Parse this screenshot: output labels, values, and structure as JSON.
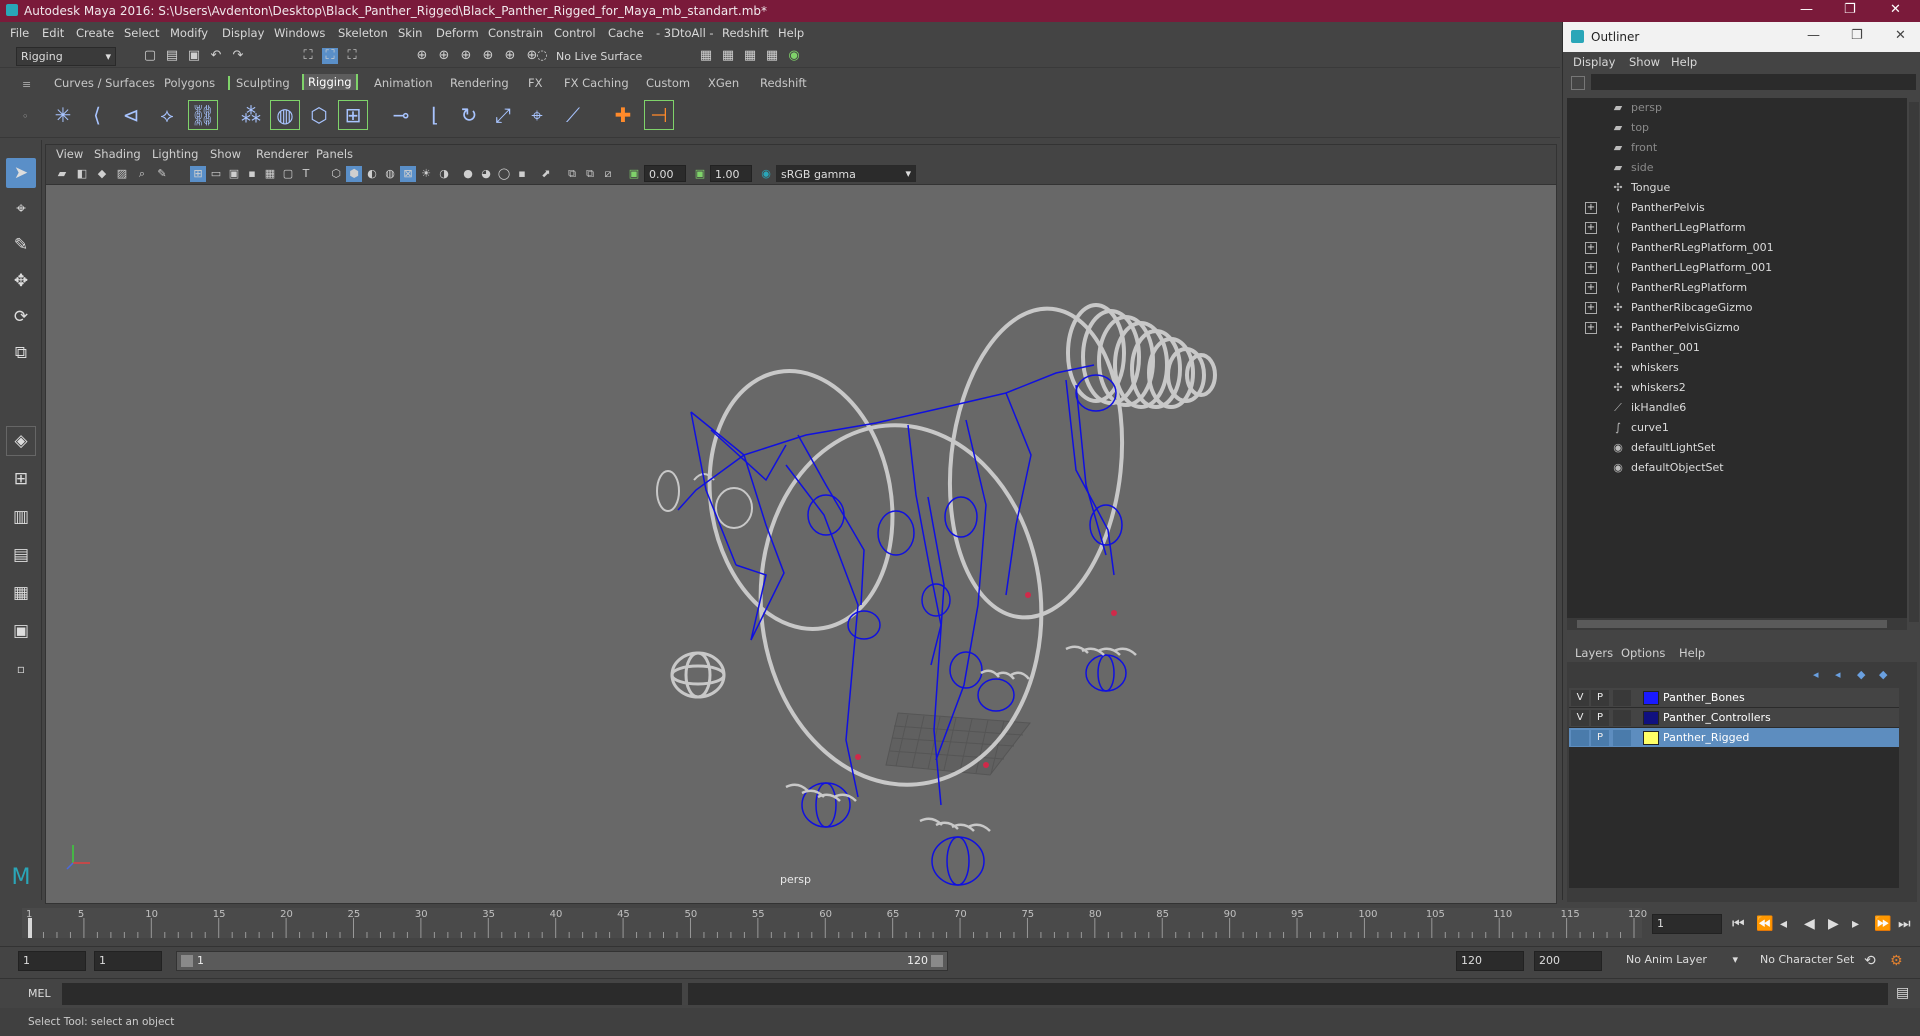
{
  "window": {
    "title": "Autodesk Maya 2016: S:\\Users\\Avdenton\\Desktop\\Black_Panther_Rigged\\Black_Panther_Rigged_for_Maya_mb_standart.mb*",
    "minimize": "—",
    "restore": "❐",
    "close": "✕"
  },
  "menubar": [
    "File",
    "Edit",
    "Create",
    "Select",
    "Modify",
    "Display",
    "Windows",
    "Skeleton",
    "Skin",
    "Deform",
    "Constrain",
    "Control",
    "Cache",
    "- 3DtoAll -",
    "Redshift",
    "Help"
  ],
  "statusline": {
    "menuset": "Rigging",
    "live_surface": "No Live Surface"
  },
  "shelf": {
    "tabs": [
      "Curves / Surfaces",
      "Polygons",
      "Sculpting",
      "Rigging",
      "Animation",
      "Rendering",
      "FX",
      "FX Caching",
      "Custom",
      "XGen",
      "Redshift"
    ],
    "active_tab": "Rigging"
  },
  "viewport": {
    "menu": [
      "View",
      "Shading",
      "Lighting",
      "Show",
      "Renderer",
      "Panels"
    ],
    "field_exposure": "0.00",
    "field_gamma": "1.00",
    "color_space": "sRGB gamma",
    "camera_label": "persp"
  },
  "outliner": {
    "title": "Outliner",
    "menu": [
      "Display",
      "Show",
      "Help"
    ],
    "items": [
      {
        "label": "persp",
        "icon": "camera-icon",
        "expandable": false,
        "dim": true
      },
      {
        "label": "top",
        "icon": "camera-icon",
        "expandable": false,
        "dim": true
      },
      {
        "label": "front",
        "icon": "camera-icon",
        "expandable": false,
        "dim": true
      },
      {
        "label": "side",
        "icon": "camera-icon",
        "expandable": false,
        "dim": true
      },
      {
        "label": "Tongue",
        "icon": "mesh-icon",
        "expandable": false,
        "dim": false
      },
      {
        "label": "PantherPelvis",
        "icon": "joint-icon",
        "expandable": true,
        "dim": false
      },
      {
        "label": "PantherLLegPlatform",
        "icon": "joint-icon",
        "expandable": true,
        "dim": false
      },
      {
        "label": "PantherRLegPlatform_001",
        "icon": "joint-icon",
        "expandable": true,
        "dim": false
      },
      {
        "label": "PantherLLegPlatform_001",
        "icon": "joint-icon",
        "expandable": true,
        "dim": false
      },
      {
        "label": "PantherRLegPlatform",
        "icon": "joint-icon",
        "expandable": true,
        "dim": false
      },
      {
        "label": "PantherRibcageGizmo",
        "icon": "mesh-icon",
        "expandable": true,
        "dim": false
      },
      {
        "label": "PantherPelvisGizmo",
        "icon": "mesh-icon",
        "expandable": true,
        "dim": false
      },
      {
        "label": "Panther_001",
        "icon": "mesh-icon",
        "expandable": false,
        "dim": false
      },
      {
        "label": "whiskers",
        "icon": "mesh-icon",
        "expandable": false,
        "dim": false
      },
      {
        "label": "whiskers2",
        "icon": "mesh-icon",
        "expandable": false,
        "dim": false
      },
      {
        "label": "ikHandle6",
        "icon": "ikhandle-icon",
        "expandable": false,
        "dim": false
      },
      {
        "label": "curve1",
        "icon": "curve-icon",
        "expandable": false,
        "dim": false
      },
      {
        "label": "defaultLightSet",
        "icon": "set-icon",
        "expandable": false,
        "dim": false
      },
      {
        "label": "defaultObjectSet",
        "icon": "set-icon",
        "expandable": false,
        "dim": false
      }
    ]
  },
  "layers": {
    "menu": [
      "Layers",
      "Options",
      "Help"
    ],
    "rows": [
      {
        "v": "V",
        "p": "P",
        "name": "Panther_Bones",
        "color": "#1a1aff",
        "selected": false
      },
      {
        "v": "V",
        "p": "P",
        "name": "Panther_Controllers",
        "color": "#101080",
        "selected": false
      },
      {
        "v": "",
        "p": "P",
        "name": "Panther_Rigged",
        "color": "#ffff66",
        "selected": true
      }
    ]
  },
  "timeline": {
    "ticks": [
      "1",
      "5",
      "10",
      "15",
      "20",
      "25",
      "30",
      "35",
      "40",
      "45",
      "50",
      "55",
      "60",
      "65",
      "70",
      "75",
      "80",
      "85",
      "90",
      "95",
      "100",
      "105",
      "110",
      "115",
      "120"
    ],
    "current_frame": "1",
    "range_start": "1",
    "range_start2": "1",
    "range_slider_start": "1",
    "range_slider_end": "120",
    "range_end": "120",
    "anim_end": "200",
    "anim_layer": "No Anim Layer",
    "character_set": "No Character Set"
  },
  "command": {
    "label": "MEL"
  },
  "help_line": "Select Tool: select an object",
  "colors": {
    "title_bar": "#7a1a3a",
    "rig_blue": "#1010e0",
    "gizmo_gray": "#c8c8c8",
    "active_green": "#7fd36a"
  }
}
